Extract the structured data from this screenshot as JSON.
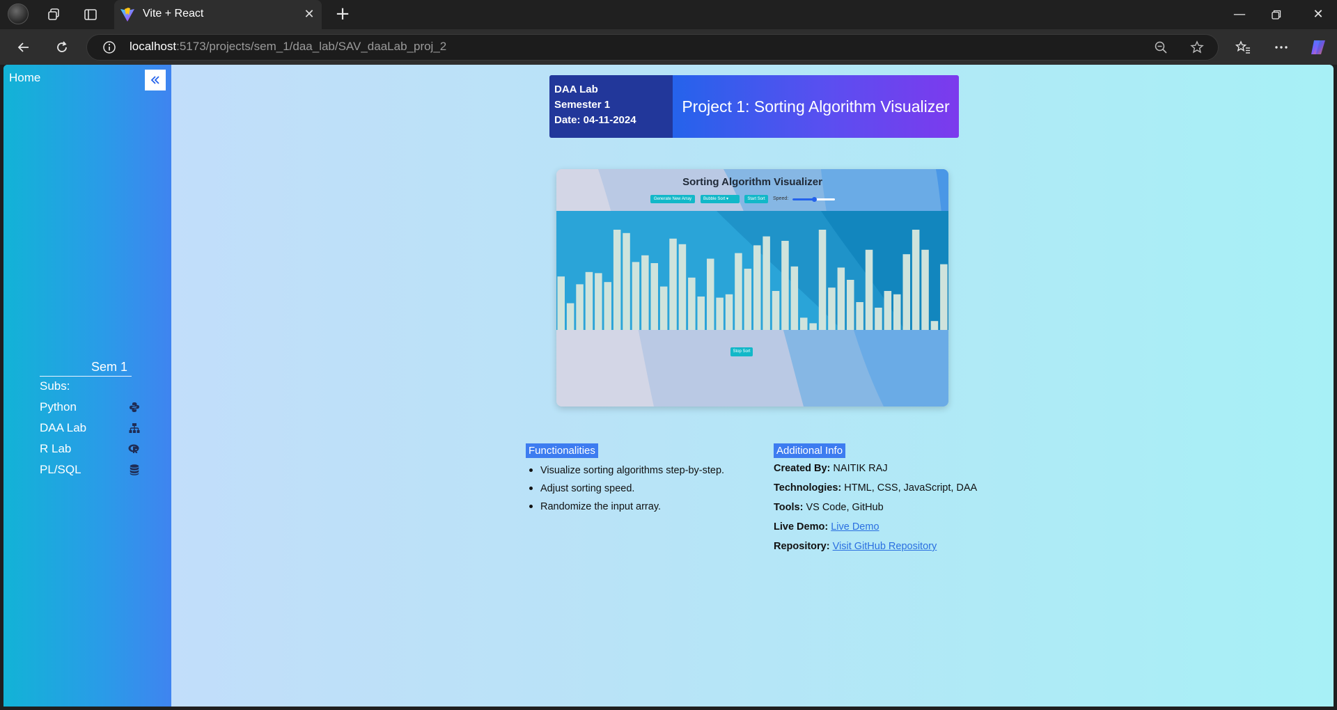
{
  "browser": {
    "tab_title": "Vite + React",
    "url_host": "localhost",
    "url_rest": ":5173/projects/sem_1/daa_lab/SAV_daaLab_proj_2"
  },
  "sidebar": {
    "home_label": "Home",
    "semester_title": "Sem 1",
    "subs_label": "Subs:",
    "items": [
      {
        "label": "Python",
        "icon": "python-icon"
      },
      {
        "label": "DAA Lab",
        "icon": "sitemap-icon"
      },
      {
        "label": "R Lab",
        "icon": "r-logo-icon"
      },
      {
        "label": "PL/SQL",
        "icon": "database-icon"
      }
    ]
  },
  "header": {
    "course": "DAA Lab",
    "semester": "Semester 1",
    "date": "Date: 04-11-2024",
    "project_title": "Project 1: Sorting Algorithm Visualizer"
  },
  "preview": {
    "title": "Sorting Algorithm Visualizer",
    "generate_button": "Generate New Array",
    "algorithm_select": "Bubble Sort",
    "start_button": "Start Sort",
    "speed_label": "Speed:",
    "speed_level": 0.5,
    "stop_button": "Stop Sort",
    "bar_heights": [
      0.48,
      0.24,
      0.41,
      0.52,
      0.51,
      0.43,
      0.9,
      0.87,
      0.61,
      0.67,
      0.6,
      0.39,
      0.82,
      0.77,
      0.47,
      0.3,
      0.64,
      0.29,
      0.32,
      0.69,
      0.55,
      0.76,
      0.84,
      0.35,
      0.8,
      0.57,
      0.11,
      0.06,
      0.9,
      0.38,
      0.56,
      0.45,
      0.25,
      0.72,
      0.2,
      0.35,
      0.32,
      0.68,
      0.9,
      0.72,
      0.08,
      0.59
    ]
  },
  "functionalities": {
    "heading": "Functionalities",
    "items": [
      "Visualize sorting algorithms step-by-step.",
      "Adjust sorting speed.",
      "Randomize the input array."
    ]
  },
  "additional_info": {
    "heading": "Additional Info",
    "created_by_label": "Created By:",
    "created_by": "NAITIK RAJ",
    "technologies_label": "Technologies:",
    "technologies": "HTML, CSS, JavaScript, DAA",
    "tools_label": "Tools:",
    "tools": "VS Code, GitHub",
    "live_demo_label": "Live Demo:",
    "live_demo_link": "Live Demo",
    "repository_label": "Repository:",
    "repository_link": "Visit GitHub Repository"
  },
  "colors": {
    "sidebar_start": "#12b3d6",
    "sidebar_end": "#3f84f0",
    "header_left": "#22379a",
    "header_gradient_end": "#7c3aed",
    "section_head": "#3d7cf0",
    "link": "#2a6fe0"
  }
}
